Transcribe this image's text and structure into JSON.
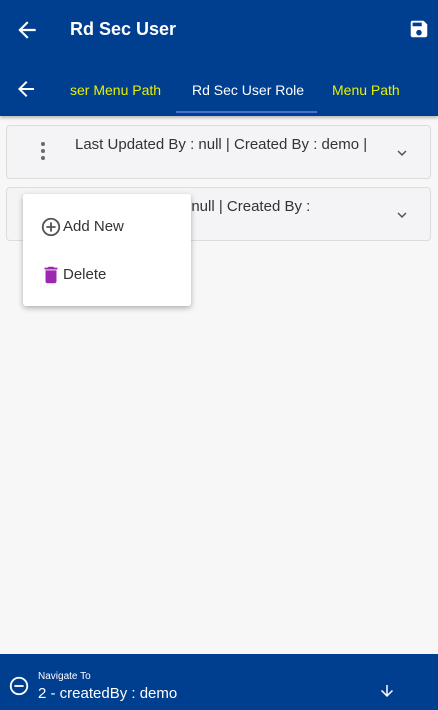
{
  "app_bar": {
    "title": "Rd Sec User",
    "back_icon": "arrow-left-icon",
    "save_icon": "save-icon"
  },
  "tabs": {
    "back_icon": "arrow-left-icon",
    "items": [
      {
        "label": "ser Menu Path"
      },
      {
        "label": "Rd Sec User Role",
        "active": true
      },
      {
        "label": "Menu Path"
      }
    ]
  },
  "records": [
    {
      "text": "Last Updated By  : null | Created By  :  demo |"
    },
    {
      "text": " : null | Created By  :"
    }
  ],
  "context_menu": {
    "items": [
      {
        "label": "Add New",
        "icon": "add-circle-icon"
      },
      {
        "label": "Delete",
        "icon": "trash-icon"
      }
    ]
  },
  "bottom_nav": {
    "label": "Navigate To",
    "value": "2 - createdBy : demo"
  },
  "colors": {
    "primary": "#003f8f",
    "tab_accent": "#e8f000",
    "delete_icon": "#9c27b0"
  }
}
